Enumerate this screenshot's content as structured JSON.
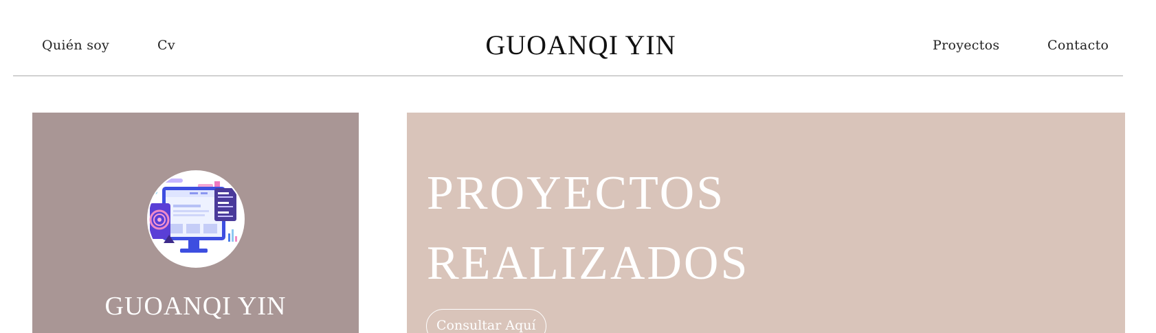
{
  "header": {
    "nav_left": [
      {
        "label": "Quién soy"
      },
      {
        "label": "Cv"
      }
    ],
    "site_title": "GUOANQI YIN",
    "nav_right": [
      {
        "label": "Proyectos"
      },
      {
        "label": "Contacto"
      }
    ]
  },
  "profile_card": {
    "avatar_icon": "computer-illustration-icon",
    "name": "GUOANQI YIN",
    "background_color": "#a99695"
  },
  "hero": {
    "title_line_1": "PROYECTOS",
    "title_line_2": "REALIZADOS",
    "button_label": "Consultar Aquí",
    "background_color": "#d9c4ba"
  }
}
